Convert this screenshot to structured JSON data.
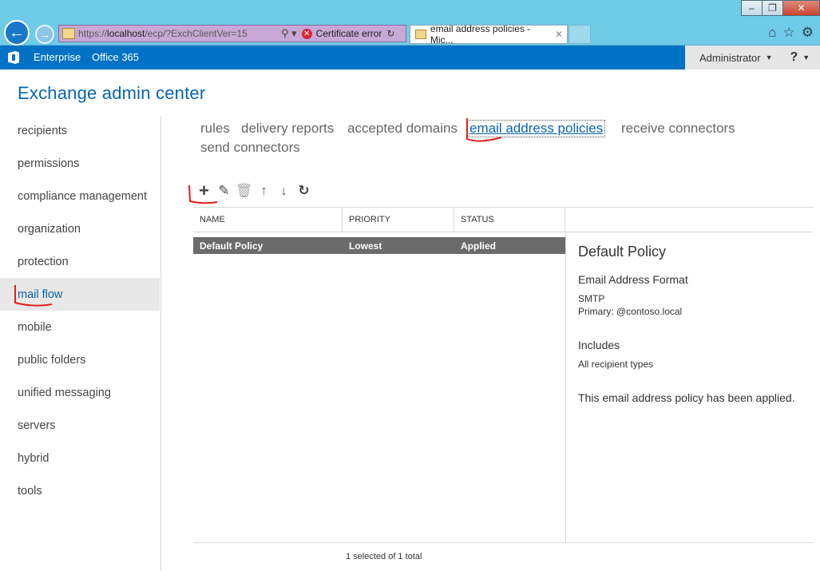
{
  "browser": {
    "url_prefix": "https://",
    "url_host": "localhost",
    "url_path": "/ecp/?ExchClientVer=15",
    "certificate_error": "Certificate error",
    "tab_title": "email address policies - Mic...",
    "window_buttons": [
      "minimize",
      "restore",
      "close"
    ]
  },
  "topbar": {
    "enterprise": "Enterprise",
    "office365": "Office 365",
    "user": "Administrator",
    "help": "?"
  },
  "page_title": "Exchange admin center",
  "sidebar": {
    "items": [
      {
        "label": "recipients"
      },
      {
        "label": "permissions"
      },
      {
        "label": "compliance management"
      },
      {
        "label": "organization"
      },
      {
        "label": "protection"
      },
      {
        "label": "mail flow",
        "active": true
      },
      {
        "label": "mobile"
      },
      {
        "label": "public folders"
      },
      {
        "label": "unified messaging"
      },
      {
        "label": "servers"
      },
      {
        "label": "hybrid"
      },
      {
        "label": "tools"
      }
    ]
  },
  "subtabs": [
    {
      "label": "rules"
    },
    {
      "label": "delivery reports"
    },
    {
      "label": "accepted domains"
    },
    {
      "label": "email address policies",
      "active": true
    },
    {
      "label": "receive connectors"
    },
    {
      "label": "send connectors"
    }
  ],
  "toolbar": {
    "icons": [
      "add-icon",
      "edit-icon",
      "delete-icon",
      "move-up-icon",
      "move-down-icon",
      "refresh-icon"
    ]
  },
  "table": {
    "columns": [
      "NAME",
      "PRIORITY",
      "STATUS"
    ],
    "rows": [
      {
        "name": "Default Policy",
        "priority": "Lowest",
        "status": "Applied",
        "selected": true
      }
    ],
    "footer": "1 selected of 1 total"
  },
  "details": {
    "title": "Default Policy",
    "format_heading": "Email Address Format",
    "format_type": "SMTP",
    "format_primary": "Primary: @contoso.local",
    "includes_heading": "Includes",
    "includes_value": "All recipient types",
    "status_message": "This email address policy has been applied."
  },
  "colors": {
    "accent": "#0072c6",
    "title": "#0a64ad",
    "selected_row": "#6b6b6b",
    "annotation": "#e0201b"
  }
}
